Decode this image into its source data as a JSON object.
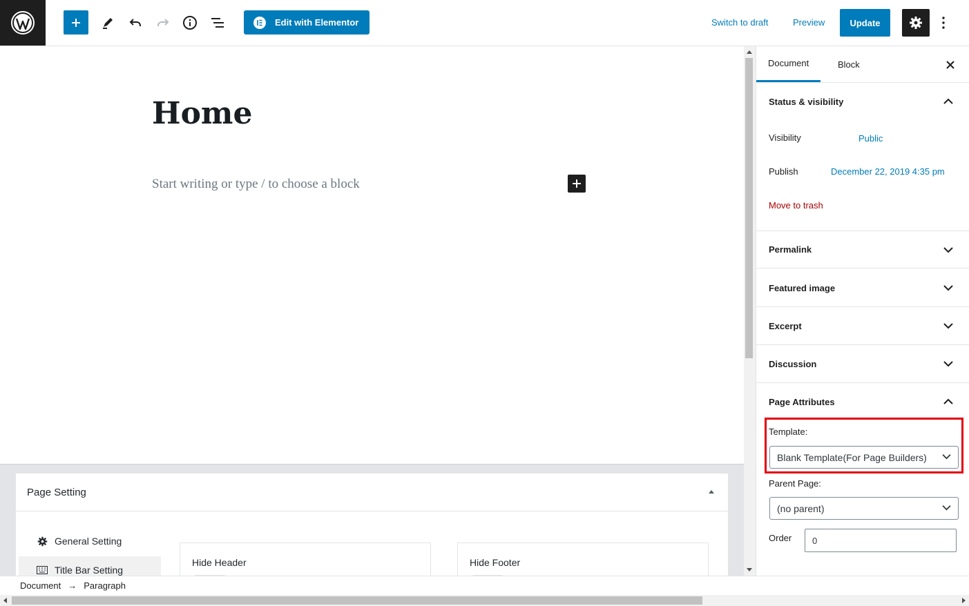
{
  "colors": {
    "accent": "#007cba",
    "dark": "#1e1e1e",
    "danger": "#a00",
    "highlight": "#e3000f"
  },
  "topbar": {
    "logo_icon": "wordpress-logo-icon",
    "elementor_label": "Edit with Elementor",
    "switch_draft": "Switch to draft",
    "preview": "Preview",
    "update": "Update"
  },
  "editor": {
    "title": "Home",
    "placeholder": "Start writing or type / to choose a block"
  },
  "metabox": {
    "title": "Page Setting",
    "tabs": [
      "General Setting",
      "Title Bar Setting"
    ],
    "fields": [
      "Hide Header",
      "Hide Footer"
    ]
  },
  "breadcrumb": {
    "items": [
      "Document",
      "Paragraph"
    ],
    "separator": "→"
  },
  "sidebar": {
    "tabs": [
      "Document",
      "Block"
    ],
    "status": {
      "title": "Status & visibility",
      "visibility_label": "Visibility",
      "visibility_value": "Public",
      "publish_label": "Publish",
      "publish_value": "December 22, 2019 4:35 pm",
      "trash": "Move to trash"
    },
    "panels": [
      "Permalink",
      "Featured image",
      "Excerpt",
      "Discussion"
    ],
    "attributes": {
      "title": "Page Attributes",
      "template_label": "Template:",
      "template_value": "Blank Template(For Page Builders)",
      "parent_label": "Parent Page:",
      "parent_value": "(no parent)",
      "order_label": "Order",
      "order_value": "0"
    }
  }
}
